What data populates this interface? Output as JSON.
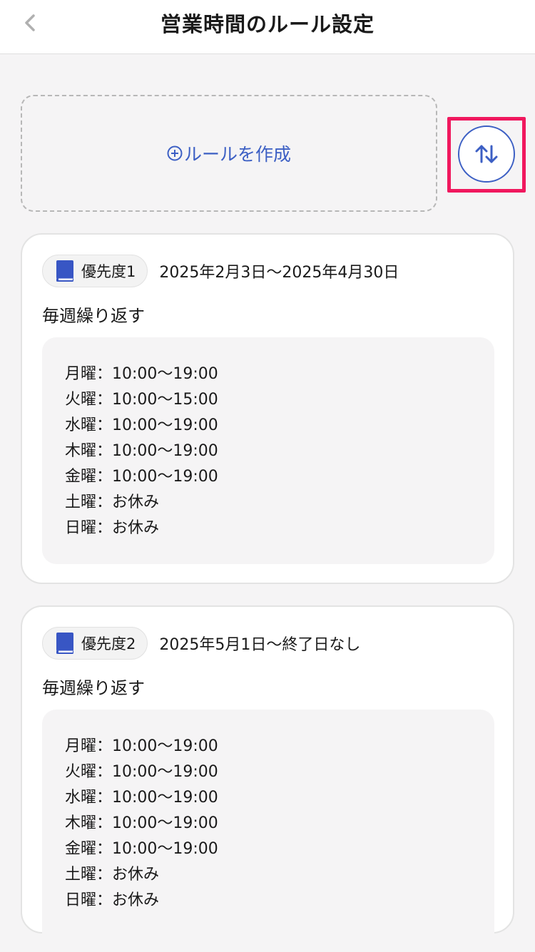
{
  "header": {
    "title": "営業時間のルール設定"
  },
  "create_rule": {
    "label": "ルールを作成"
  },
  "rules": [
    {
      "priority": "優先度1",
      "date_range": "2025年2月3日〜2025年4月30日",
      "repeat": "毎週繰り返す",
      "hours": [
        "月曜：10:00〜19:00",
        "火曜：10:00〜15:00",
        "水曜：10:00〜19:00",
        "木曜：10:00〜19:00",
        "金曜：10:00〜19:00",
        "土曜：お休み",
        "日曜：お休み"
      ]
    },
    {
      "priority": "優先度2",
      "date_range": "2025年5月1日〜終了日なし",
      "repeat": "毎週繰り返す",
      "hours": [
        "月曜：10:00〜19:00",
        "火曜：10:00〜19:00",
        "水曜：10:00〜19:00",
        "木曜：10:00〜19:00",
        "金曜：10:00〜19:00",
        "土曜：お休み",
        "日曜：お休み"
      ]
    }
  ],
  "colors": {
    "accent": "#3c5fc4",
    "highlight": "#f0185e",
    "background": "#f5f4f5"
  },
  "icons": {
    "back": "chevron-left-icon",
    "add": "plus-circle-icon",
    "sort": "sort-arrows-icon",
    "priority": "book-icon"
  }
}
